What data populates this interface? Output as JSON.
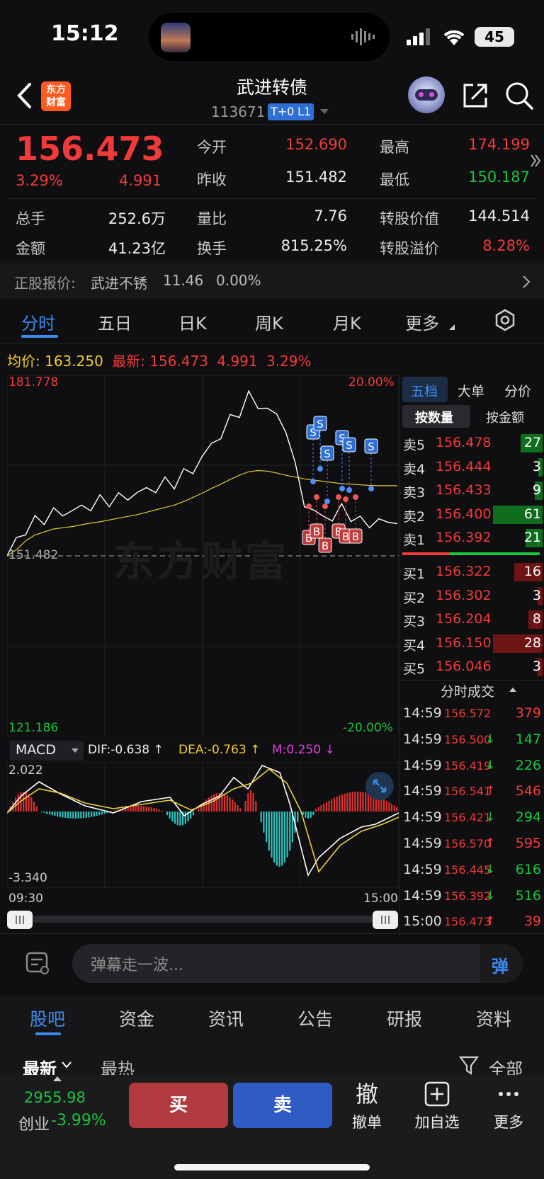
{
  "status": {
    "time": "15:12",
    "battery": "45"
  },
  "header": {
    "title": "武进转债",
    "code": "113671",
    "tags": [
      "T+0",
      "L1"
    ],
    "logo": "东方\n财富"
  },
  "quote": {
    "price": "156.473",
    "pct": "3.29%",
    "chg": "4.991",
    "open_label": "今开",
    "open": "152.690",
    "high_label": "最高",
    "high": "174.199",
    "prev_label": "昨收",
    "prev": "151.482",
    "low_label": "最低",
    "low": "150.187",
    "vol_label": "总手",
    "vol": "252.6万",
    "vr_label": "量比",
    "vr": "7.76",
    "conv_label": "转股价值",
    "conv": "144.514",
    "amt_label": "金额",
    "amt": "41.23亿",
    "turn_label": "换手",
    "turn": "815.25%",
    "prem_label": "转股溢价",
    "prem": "8.28%"
  },
  "underlying": {
    "label": "正股报价:",
    "name": "武进不锈",
    "price": "11.46",
    "pct": "0.00%"
  },
  "chart_tabs": [
    "分时",
    "五日",
    "日K",
    "周K",
    "月K",
    "更多"
  ],
  "avg_line": {
    "avg_label": "均价:",
    "avg": "163.250",
    "last_label": "最新:",
    "last": "156.473",
    "chg": "4.991",
    "pct": "3.29%"
  },
  "chart_axis": {
    "top": "181.778",
    "top_pct": "20.00%",
    "mid": "151.482",
    "bottom": "121.186",
    "bottom_pct": "-20.00%",
    "watermark": "东方财富"
  },
  "macd": {
    "name": "MACD",
    "dif": "DIF:-0.638 ↑",
    "dea": "DEA:-0.763 ↑",
    "m": "M:0.250 ↓",
    "top": "2.022",
    "bottom": "-3.340",
    "start": "09:30",
    "end": "15:00"
  },
  "chart_data": {
    "type": "line",
    "ylim": [
      121.186,
      181.778
    ],
    "x_start": "09:30",
    "x_end": "15:00",
    "series": [
      {
        "values": [
          151.5,
          154,
          156,
          157,
          158,
          158.5,
          158.8,
          159,
          159.5,
          160,
          160.5,
          161,
          161,
          161.5,
          162,
          162.5,
          163,
          163.5,
          164,
          165,
          166,
          168,
          170,
          172,
          174,
          176,
          178,
          177,
          176,
          175,
          173,
          166,
          161,
          158,
          159,
          157,
          160,
          158,
          157,
          157.5,
          156.5,
          158,
          156.5
        ]
      },
      {
        "values": [
          151.5,
          152.5,
          154,
          155,
          155.5,
          156,
          156.2,
          156.4,
          156.7,
          157,
          157.2,
          157.5,
          157.8,
          158.1,
          158.4,
          158.8,
          159.2,
          159.6,
          160,
          160.6,
          161.3,
          162,
          162.8,
          163.5,
          164.3,
          165,
          165.6,
          165.8,
          165.7,
          165.4,
          165,
          164.7,
          164.4,
          164.2,
          164,
          163.8,
          163.6,
          163.5,
          163.4,
          163.3,
          163.25,
          163.25,
          163.25
        ]
      }
    ],
    "signals": [
      "S",
      "S",
      "S",
      "S",
      "S",
      "S",
      "B",
      "B",
      "B",
      "B",
      "B",
      "B"
    ]
  },
  "orderbook": {
    "tabs": [
      "五档",
      "大单",
      "分价"
    ],
    "subtabs": [
      "按数量",
      "按金额"
    ],
    "asks": [
      {
        "label": "卖5",
        "price": "156.478",
        "qty": "27",
        "bar": 0.44
      },
      {
        "label": "卖4",
        "price": "156.444",
        "qty": "3",
        "bar": 0.05
      },
      {
        "label": "卖3",
        "price": "156.433",
        "qty": "9",
        "bar": 0.15
      },
      {
        "label": "卖2",
        "price": "156.400",
        "qty": "61",
        "bar": 1.0
      },
      {
        "label": "卖1",
        "price": "156.392",
        "qty": "21",
        "bar": 0.34
      }
    ],
    "bids": [
      {
        "label": "买1",
        "price": "156.322",
        "qty": "16",
        "bar": 0.57
      },
      {
        "label": "买2",
        "price": "156.302",
        "qty": "3",
        "bar": 0.1
      },
      {
        "label": "买3",
        "price": "156.204",
        "qty": "8",
        "bar": 0.28
      },
      {
        "label": "买4",
        "price": "156.150",
        "qty": "28",
        "bar": 1.0
      },
      {
        "label": "买5",
        "price": "156.046",
        "qty": "3",
        "bar": 0.1
      }
    ]
  },
  "trades": {
    "title": "分时成交",
    "rows": [
      {
        "time": "14:59",
        "price": "156.572",
        "arrow": "",
        "qty": "379",
        "dir": "up"
      },
      {
        "time": "14:59",
        "price": "156.500",
        "arrow": "↓",
        "qty": "147",
        "dir": "down"
      },
      {
        "time": "14:59",
        "price": "156.419",
        "arrow": "↓",
        "qty": "226",
        "dir": "down"
      },
      {
        "time": "14:59",
        "price": "156.541",
        "arrow": "↑",
        "qty": "546",
        "dir": "up"
      },
      {
        "time": "14:59",
        "price": "156.421",
        "arrow": "↓",
        "qty": "294",
        "dir": "down"
      },
      {
        "time": "14:59",
        "price": "156.570",
        "arrow": "↑",
        "qty": "595",
        "dir": "up"
      },
      {
        "time": "14:59",
        "price": "156.445",
        "arrow": "↓",
        "qty": "616",
        "dir": "down"
      },
      {
        "time": "14:59",
        "price": "156.392",
        "arrow": "↓",
        "qty": "516",
        "dir": "down"
      },
      {
        "time": "15:00",
        "price": "156.473",
        "arrow": "↑",
        "qty": "39",
        "dir": "up"
      }
    ]
  },
  "danmaku": {
    "placeholder": "弹幕走一波...",
    "button": "弹"
  },
  "bottom_tabs": [
    "股吧",
    "资金",
    "资讯",
    "公告",
    "研报",
    "资料"
  ],
  "filters": {
    "latest": "最新",
    "hot": "最热",
    "all": "全部"
  },
  "footer": {
    "index_value": "2955.98",
    "index_name": "创业",
    "index_pct": "-3.99%",
    "buy": "买",
    "sell": "卖",
    "cancel_icon": "撤",
    "cancel": "撤单",
    "add": "加自选",
    "more": "更多"
  },
  "colors": {
    "up": "#f23a3a",
    "down": "#19c63a",
    "accent": "#2f6fd6",
    "avg": "#e3c832"
  }
}
